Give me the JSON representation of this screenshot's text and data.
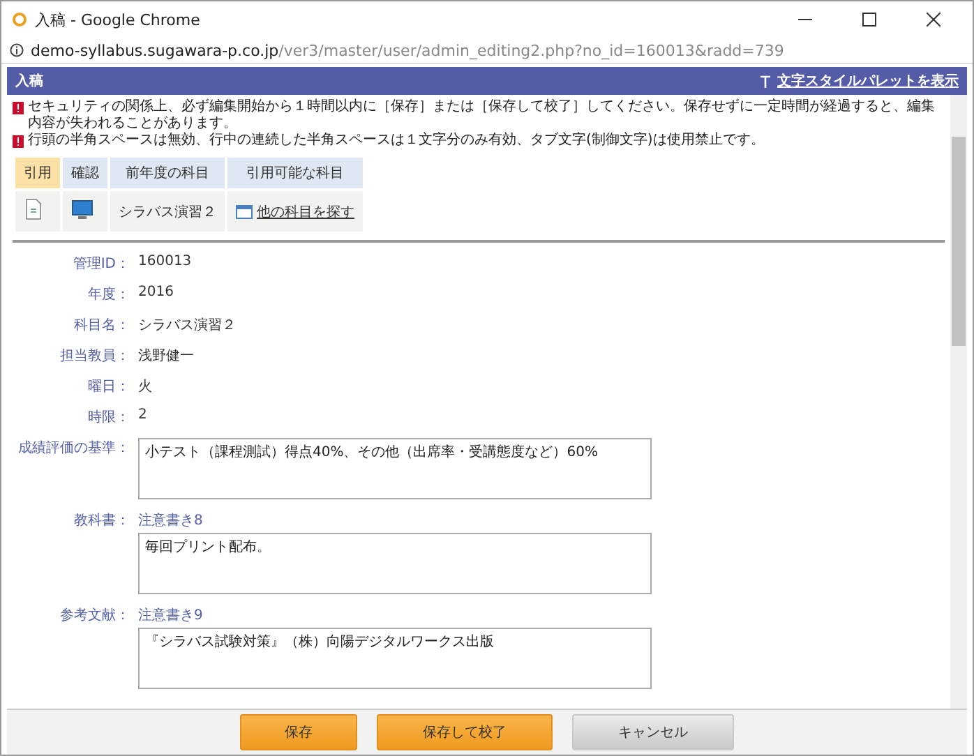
{
  "window": {
    "title": "入稿 - Google Chrome"
  },
  "address": {
    "host": "demo-syllabus.sugawara-p.co.jp",
    "path": "/ver3/master/user/admin_editing2.php?no_id=160013&radd=739"
  },
  "header": {
    "title": "入稿",
    "link": "文字スタイルパレットを表示"
  },
  "warnings": [
    "セキュリティの関係上、必ず編集開始から１時間以内に［保存］または［保存して校了］してください。保存せずに一定時間が経過すると、編集内容が失われることがあります。",
    "行頭の半角スペースは無効、行中の連続した半角スペースは１文字分のみ有効、タブ文字(制御文字)は使用禁止です。"
  ],
  "quote_table": {
    "headers": [
      {
        "label": "引用",
        "selected": true
      },
      {
        "label": "確認",
        "selected": false
      },
      {
        "label": "前年度の科目",
        "selected": false
      },
      {
        "label": "引用可能な科目",
        "selected": false
      }
    ],
    "cells": [
      {
        "kind": "doc-icon"
      },
      {
        "kind": "monitor-icon"
      },
      {
        "kind": "text",
        "text": "シラバス演習２"
      },
      {
        "kind": "link",
        "text": "他の科目を探す"
      }
    ]
  },
  "fields": [
    {
      "kind": "text",
      "label": "管理ID：",
      "value": "160013"
    },
    {
      "kind": "text",
      "label": "年度：",
      "value": "2016"
    },
    {
      "kind": "text",
      "label": "科目名：",
      "value": "シラバス演習２"
    },
    {
      "kind": "text",
      "label": "担当教員：",
      "value": "浅野健一"
    },
    {
      "kind": "text",
      "label": "曜日：",
      "value": "火"
    },
    {
      "kind": "text",
      "label": "時限：",
      "value": "2"
    },
    {
      "kind": "textarea",
      "label": "成績評価の基準：",
      "value": "小テスト（課程測試）得点40%、その他（出席率・受講態度など）60%"
    },
    {
      "kind": "textarea",
      "label": "教科書：",
      "note": "注意書き8",
      "value": "毎回プリント配布。"
    },
    {
      "kind": "textarea",
      "label": "参考文献：",
      "note": "注意書き9",
      "value": "『シラバス試験対策』（株）向陽デジタルワークス出版"
    }
  ],
  "buttons": [
    {
      "label": "保存",
      "kind": "primary"
    },
    {
      "label": "保存して校了",
      "kind": "primary"
    },
    {
      "label": "キャンセル",
      "kind": "secondary"
    }
  ]
}
